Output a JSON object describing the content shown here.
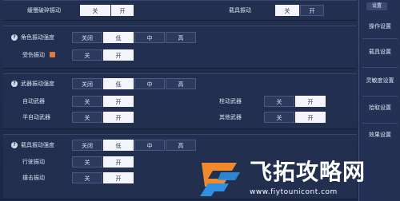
{
  "top_row": {
    "left_label": "缓慢破碎振动",
    "left_options": [
      "关",
      "开"
    ],
    "right_label": "载具振动",
    "right_options": [
      "关",
      "开"
    ]
  },
  "sidebar": {
    "close_label": "设置",
    "items": [
      "操作设置",
      "载具设置",
      "灵敏度设置",
      "拾取设置",
      "效果设置"
    ]
  },
  "character_section": {
    "strength_label": "角色振动强度",
    "strength_options": [
      "关闭",
      "低",
      "中",
      "高"
    ],
    "strength_selected": "低",
    "hurt_label": "受伤振动",
    "hurt_options": [
      "关",
      "开"
    ],
    "hurt_selected": "开"
  },
  "weapon_section": {
    "strength_label": "武器振动强度",
    "strength_options": [
      "关闭",
      "低",
      "中",
      "高"
    ],
    "strength_selected": "低",
    "auto_label": "自动武器",
    "auto_options": [
      "关",
      "开"
    ],
    "auto_selected": "开",
    "semi_label": "半自动武器",
    "semi_options": [
      "关",
      "开"
    ],
    "semi_selected": "开",
    "bolt_label": "栓动武器",
    "bolt_options": [
      "关",
      "开"
    ],
    "bolt_selected": "开",
    "other_label": "其他武器",
    "other_options": [
      "关",
      "开"
    ],
    "other_selected": "开"
  },
  "vehicle_section": {
    "strength_label": "载具振动强度",
    "strength_options": [
      "关闭",
      "低",
      "中",
      "高"
    ],
    "strength_selected": "低",
    "drive_label": "行驶振动",
    "drive_options": [
      "关",
      "开"
    ],
    "drive_selected": "开",
    "crash_label": "撞击振动",
    "crash_options": [
      "关",
      "开"
    ],
    "crash_selected": "开"
  },
  "watermark": {
    "title": "飞拓攻略网",
    "url": "www.fiytounicont.com"
  },
  "colors": {
    "selected_bg": "#f3f5fb",
    "panel_bg": "#243050",
    "accent_logo_orange": "#f08a2c",
    "accent_logo_blue": "#2f8fe0"
  }
}
